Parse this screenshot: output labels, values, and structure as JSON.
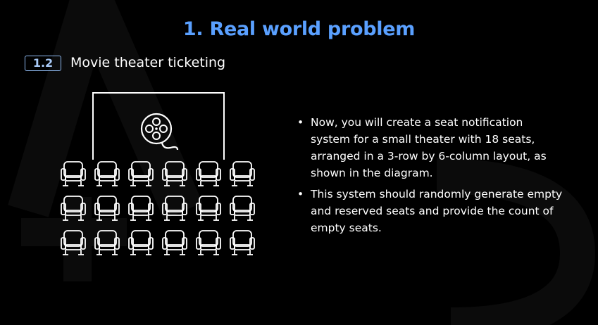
{
  "header": {
    "title": "1. Real world problem"
  },
  "section": {
    "number": "1.2",
    "title": "Movie theater ticketing"
  },
  "diagram": {
    "screen_icon": "film-reel-icon",
    "seat_icon": "cinema-seat-icon",
    "seat_rows": 3,
    "seat_columns": 6
  },
  "bullets": [
    {
      "marker": "•",
      "text": "Now, you will create a seat notification system for a small theater with 18 seats, arranged in a 3-row by 6-column layout, as shown in the diagram."
    },
    {
      "marker": "•",
      "text": "This system should randomly generate empty and reserved seats and provide the count of empty seats."
    }
  ],
  "colors": {
    "background": "#000000",
    "title": "#5aa0ff",
    "badge_border": "#8fbaf2",
    "text": "#ffffff"
  }
}
